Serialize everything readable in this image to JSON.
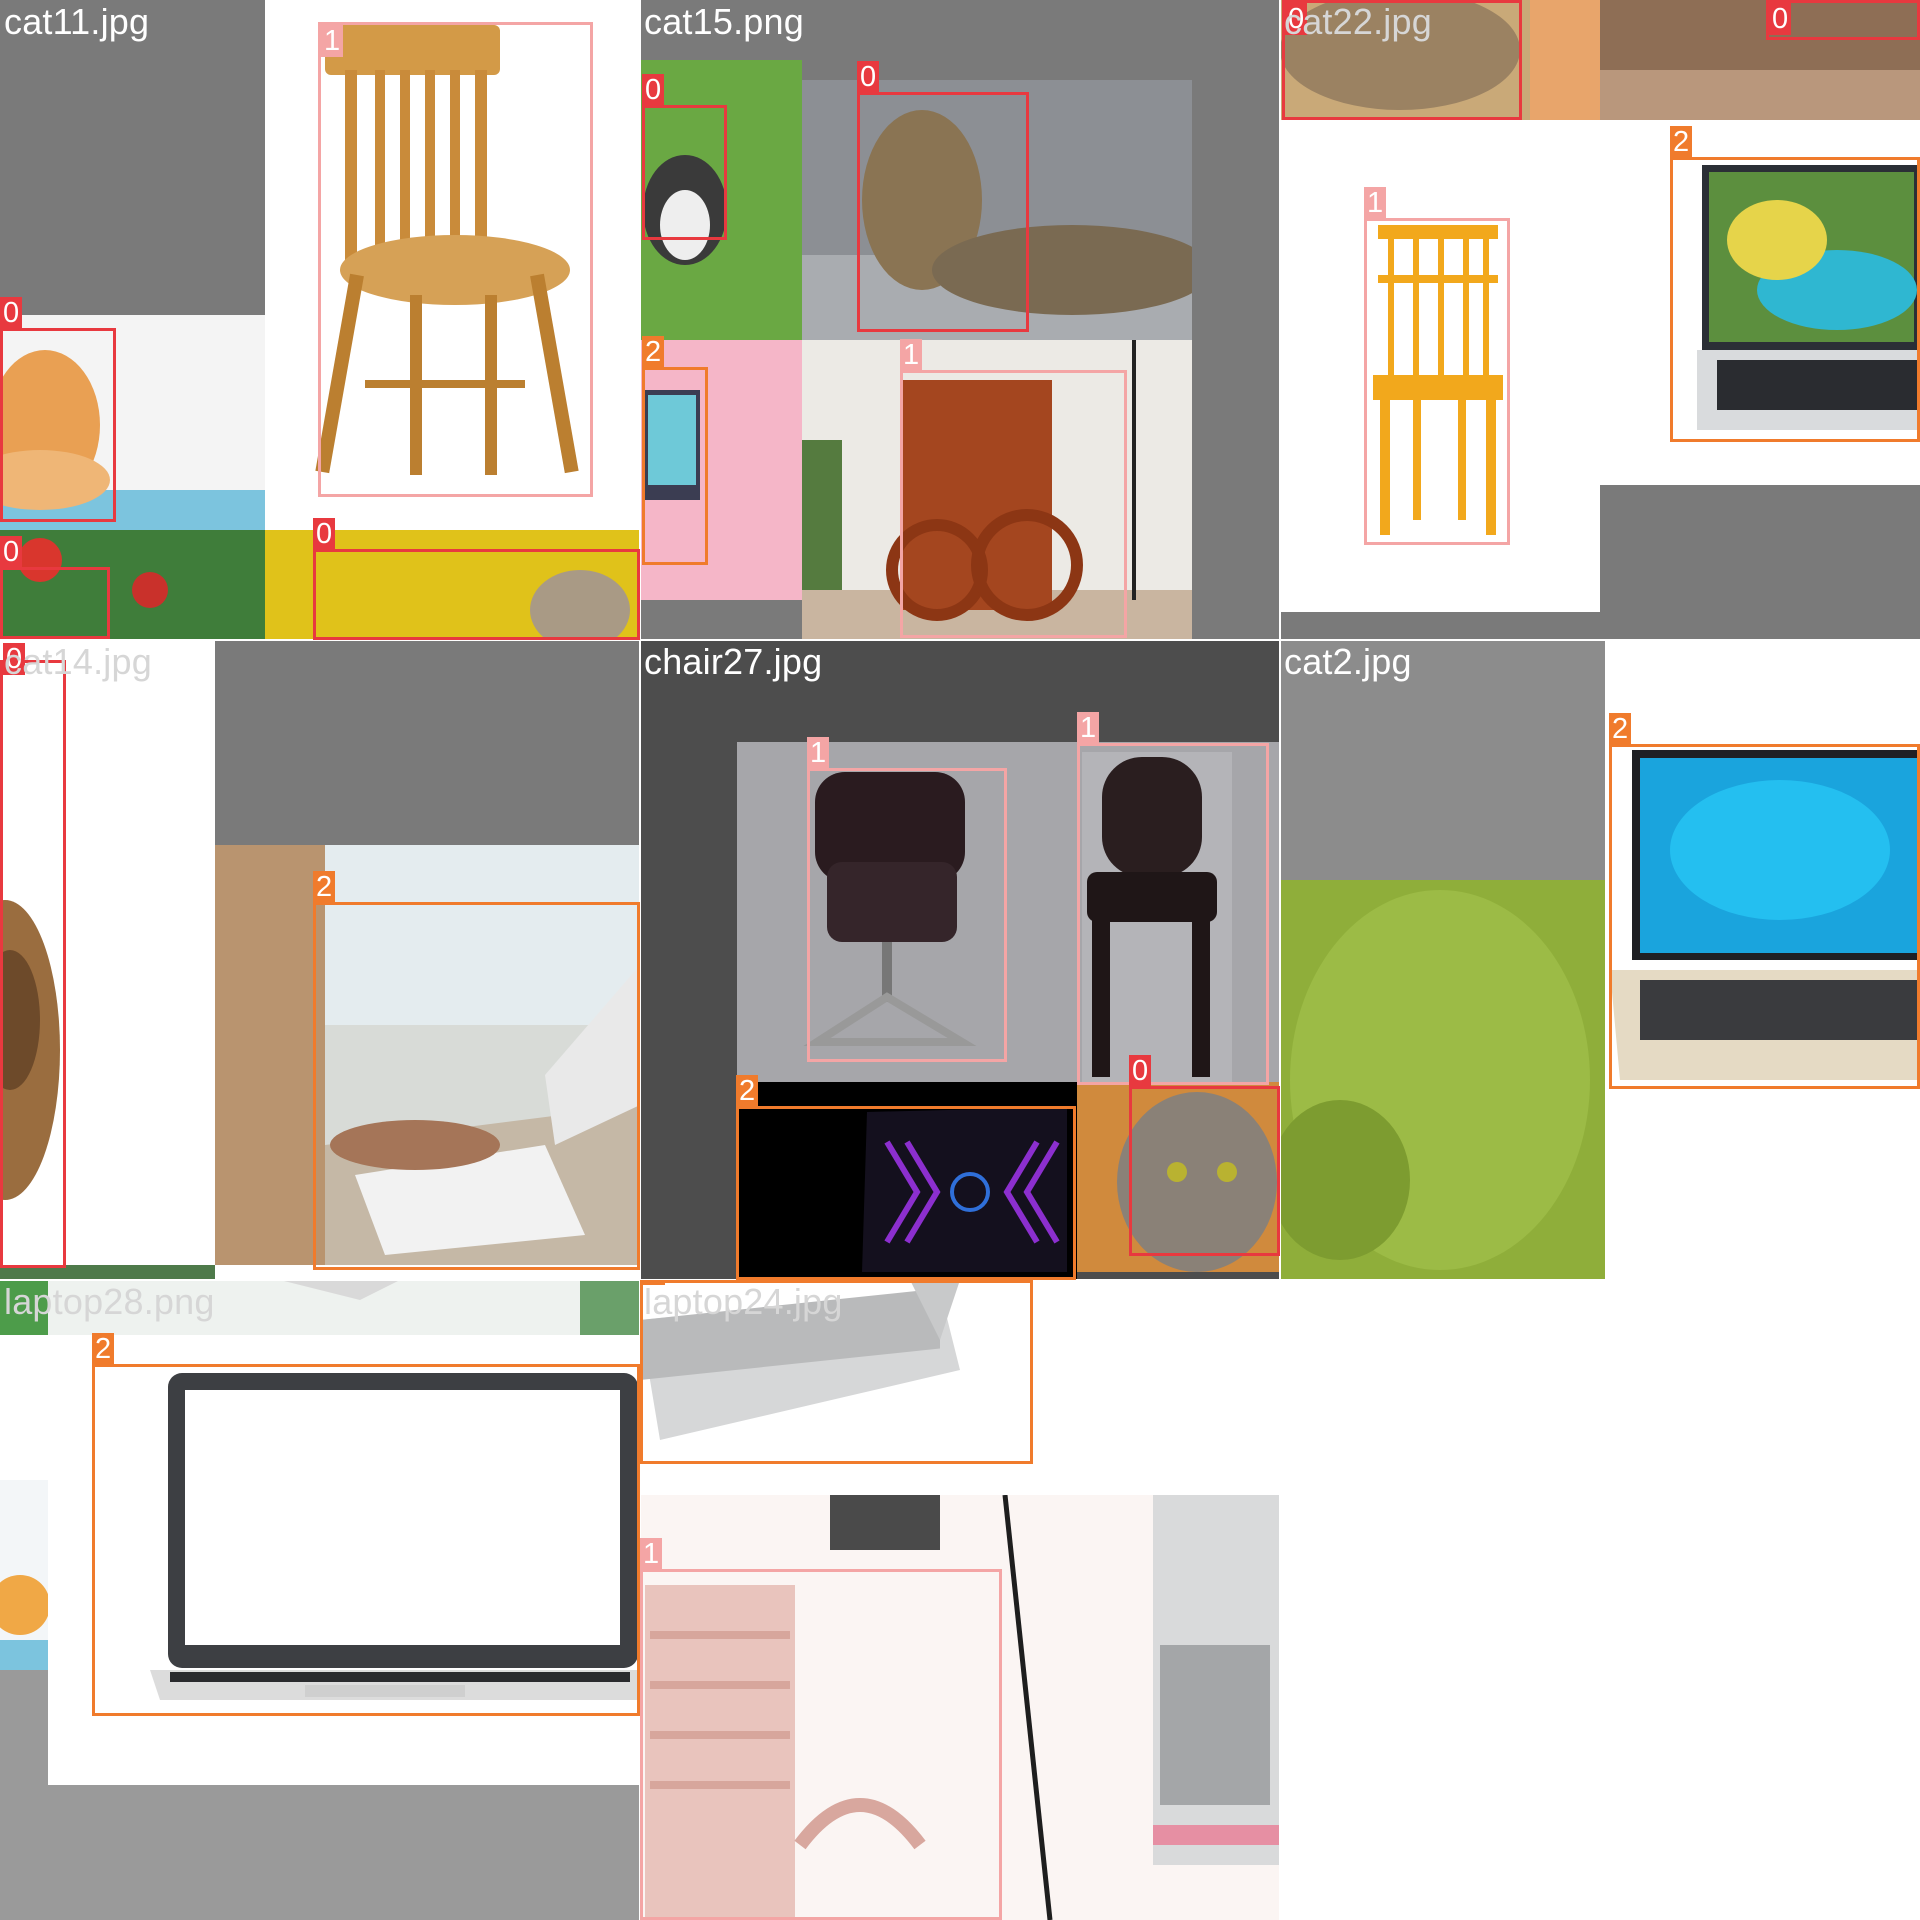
{
  "colors": {
    "class_0": "#e8393f",
    "class_1": "#f4a5a5",
    "class_2": "#f07b2c",
    "pad_gray": "#7a7a7a",
    "pad_gray_light": "#8c8c8c",
    "pad_dark": "#4d4d4d"
  },
  "icons": [
    "cat-photo",
    "chair-photo",
    "laptop-photo"
  ],
  "tiles": [
    {
      "caption": "cat11.jpg",
      "labels": [
        "1",
        "0",
        "0",
        "0"
      ]
    },
    {
      "caption": "cat15.png",
      "labels": [
        "0",
        "0",
        "2",
        "1"
      ]
    },
    {
      "caption": "cat22.jpg",
      "labels": [
        "0",
        "0",
        "2",
        "1"
      ]
    },
    {
      "caption": "cat14.jpg",
      "labels": [
        "0",
        "2"
      ]
    },
    {
      "caption": "chair27.jpg",
      "labels": [
        "1",
        "1",
        "2",
        "0"
      ]
    },
    {
      "caption": "cat2.jpg",
      "labels": [
        "2"
      ]
    },
    {
      "caption": "laptop28.png",
      "labels": [
        "2"
      ]
    },
    {
      "caption": "laptop24.jpg",
      "labels": [
        "2",
        "1"
      ]
    }
  ]
}
